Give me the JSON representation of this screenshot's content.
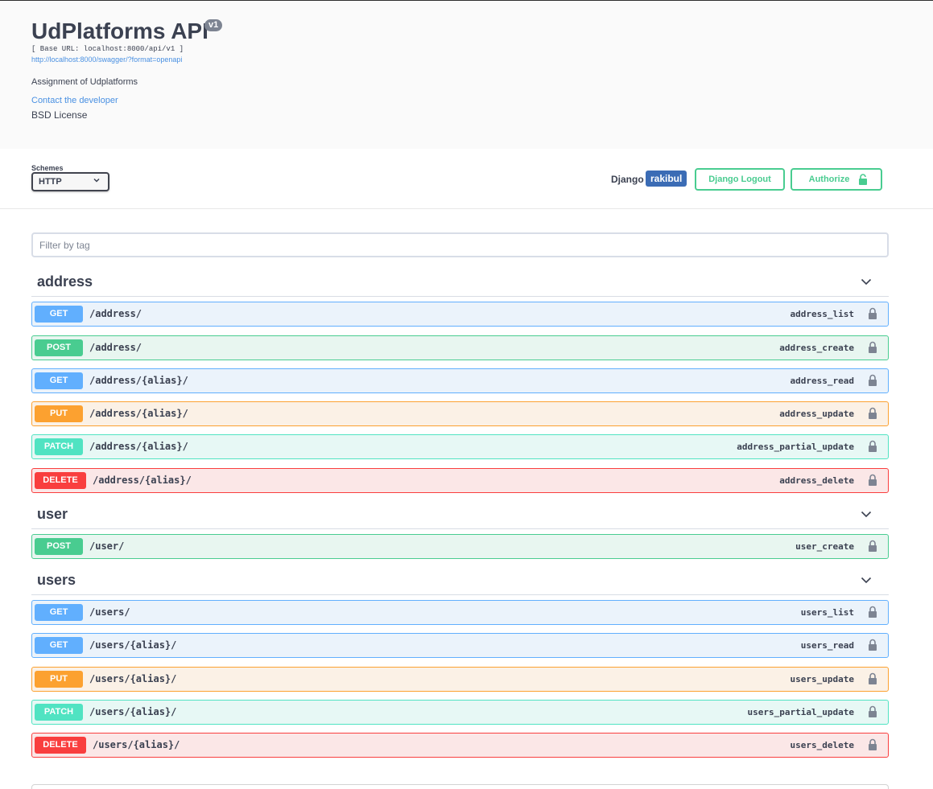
{
  "info": {
    "title": "UdPlatforms API",
    "version": "v1",
    "base_url": "[ Base URL: localhost:8000/api/v1 ]",
    "spec_link": "http://localhost:8000/swagger/?format=openapi",
    "description": "Assignment of Udplatforms",
    "contact": "Contact the developer",
    "license": "BSD License"
  },
  "schemes": {
    "label": "Schemes",
    "selected": "HTTP"
  },
  "auth": {
    "django_label": "Django",
    "username": "rakibul",
    "logout_label": "Django Logout",
    "authorize_label": "Authorize"
  },
  "filter": {
    "placeholder": "Filter by tag"
  },
  "tags": [
    {
      "name": "address",
      "operations": [
        {
          "method": "GET",
          "path": "/address/",
          "summary": "address_list"
        },
        {
          "method": "POST",
          "path": "/address/",
          "summary": "address_create"
        },
        {
          "method": "GET",
          "path": "/address/{alias}/",
          "summary": "address_read"
        },
        {
          "method": "PUT",
          "path": "/address/{alias}/",
          "summary": "address_update"
        },
        {
          "method": "PATCH",
          "path": "/address/{alias}/",
          "summary": "address_partial_update"
        },
        {
          "method": "DELETE",
          "path": "/address/{alias}/",
          "summary": "address_delete"
        }
      ]
    },
    {
      "name": "user",
      "operations": [
        {
          "method": "POST",
          "path": "/user/",
          "summary": "user_create"
        }
      ]
    },
    {
      "name": "users",
      "operations": [
        {
          "method": "GET",
          "path": "/users/",
          "summary": "users_list"
        },
        {
          "method": "GET",
          "path": "/users/{alias}/",
          "summary": "users_read"
        },
        {
          "method": "PUT",
          "path": "/users/{alias}/",
          "summary": "users_update"
        },
        {
          "method": "PATCH",
          "path": "/users/{alias}/",
          "summary": "users_partial_update"
        },
        {
          "method": "DELETE",
          "path": "/users/{alias}/",
          "summary": "users_delete"
        }
      ]
    }
  ],
  "icons": {
    "select_chevron": "chevron-down-icon",
    "tag_toggle": "chevron-down-icon",
    "authorize": "lock-open-icon",
    "operation_auth": "lock-icon"
  },
  "colors": {
    "get": "#61affe",
    "post": "#49cc90",
    "put": "#fca130",
    "patch": "#50e3c2",
    "delete": "#f93e3e",
    "link": "#4990e2",
    "user_badge": "#3b6cb5"
  }
}
